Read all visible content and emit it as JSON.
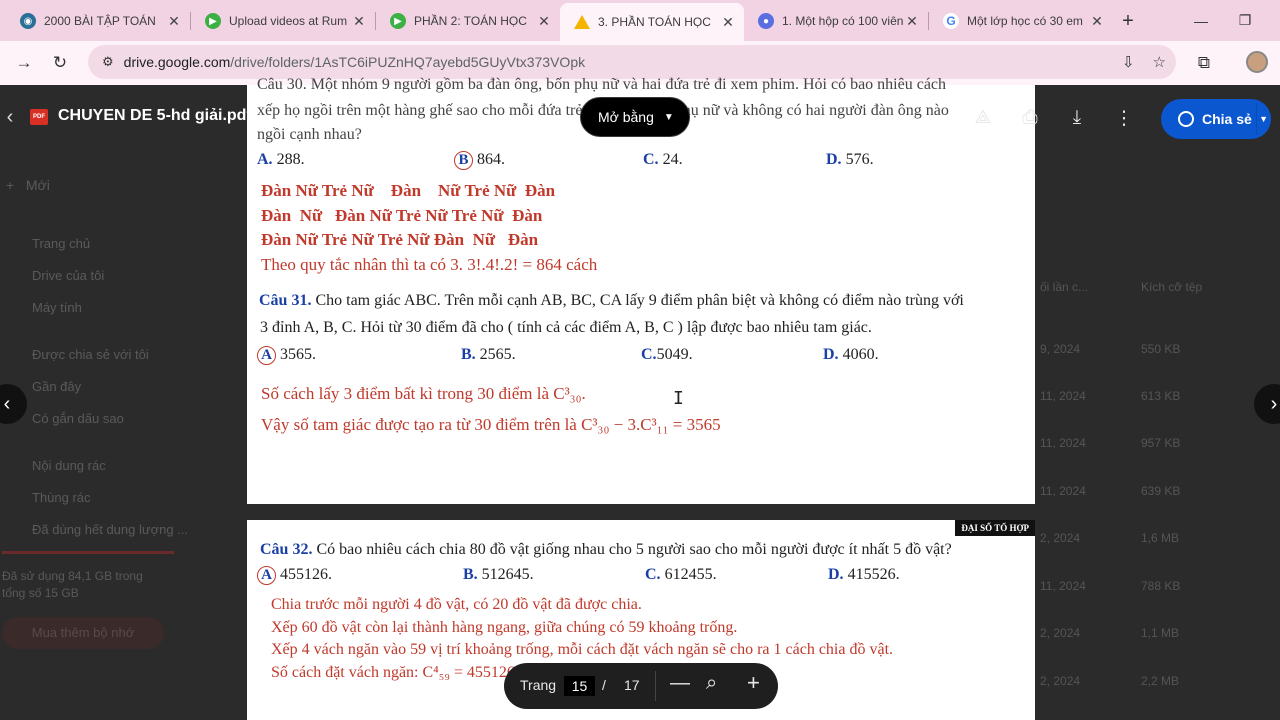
{
  "tabs": [
    {
      "title": "2000 BÀI TẬP TOÁN",
      "color": "#2a6f97"
    },
    {
      "title": "Upload videos at Rum",
      "color": "#3cb043"
    },
    {
      "title": "PHẦN 2: TOÁN HỌC",
      "color": "#3cb043"
    },
    {
      "title": "3. PHẦN TOÁN HỌC",
      "color": "#f4b400",
      "active": true
    },
    {
      "title": "1. Một hộp có 100 viên",
      "color": "#5b6ee1"
    },
    {
      "title": "Một lớp học có 30 em",
      "color": "#ffffff"
    }
  ],
  "address": {
    "host": "drive.google.com",
    "path": "/drive/folders/1AsTC6iPUZnHQ7ayebd5GUyVtx373VOpk"
  },
  "drive_sidebar": {
    "new_label": "Mới",
    "items": [
      "Trang chủ",
      "Drive của tôi",
      "Máy tính",
      "Được chia sẻ với tôi",
      "Gần đây",
      "Có gắn dấu sao",
      "Nội dung rác",
      "Thùng rác",
      "Đã dùng hết dung lượng ..."
    ],
    "storage_text_1": "Đã sử dụng 84,1 GB trong",
    "storage_text_2": "tổng số 15 GB",
    "buy_label": "Mua thêm bộ nhớ"
  },
  "drive_right": {
    "col1": "ối lần c...",
    "col2": "Kích cỡ tệp",
    "rows": [
      {
        "date": "9, 2024",
        "size": "550 KB"
      },
      {
        "date": "11, 2024",
        "size": "613 KB"
      },
      {
        "date": "11, 2024",
        "size": "957 KB"
      },
      {
        "date": "11, 2024",
        "size": "639 KB"
      },
      {
        "date": "2, 2024",
        "size": "1,6 MB"
      },
      {
        "date": "11, 2024",
        "size": "788 KB"
      },
      {
        "date": "2, 2024",
        "size": "1,1 MB"
      },
      {
        "date": "2, 2024",
        "size": "2,2 MB"
      }
    ]
  },
  "pdf": {
    "badge": "PDF",
    "title": "CHUYEN DE 5-hd giải.pdf",
    "open_with": "Mở bằng",
    "share": "Chia sẻ"
  },
  "page1": {
    "ghost1": "Câu 30. Một nhóm 9 người gồm ba đàn ông, bốn phụ nữ và hai đứa trẻ đi xem phim. Hỏi có bao nhiêu cách",
    "ghost2": "xếp họ ngồi trên một hàng ghế sao cho mỗi đứa trẻ ngồi giữa hai phụ nữ và không có hai người đàn ông nào",
    "ghost3": "ngồi cạnh nhau?",
    "q30_opts": [
      {
        "l": "A.",
        "v": "288."
      },
      {
        "l": "B",
        "v": "864."
      },
      {
        "l": "C.",
        "v": "24."
      },
      {
        "l": "D.",
        "v": "576."
      }
    ],
    "arr1": "Đàn Nữ Trẻ Nữ    Đàn    Nữ Trẻ Nữ  Đàn",
    "arr2": "Đàn  Nữ   Đàn Nữ Trẻ Nữ Trẻ Nữ  Đàn",
    "arr3": "Đàn Nữ Trẻ Nữ Trẻ Nữ Đàn  Nữ   Đàn",
    "rule": "Theo quy tắc nhân thì ta có 3. 3!.4!.2! = 864  cách",
    "q31_label": "Câu 31.",
    "q31_l1": " Cho tam giác ABC. Trên mỗi cạnh AB, BC, CA lấy 9 điểm phân biệt và không có điểm nào trùng với",
    "q31_l2": "3 đỉnh A, B, C. Hỏi từ 30 điểm đã cho ( tính cả các điểm A, B, C ) lập được bao nhiêu tam giác.",
    "q31_opts": [
      {
        "l": "A",
        "v": "3565."
      },
      {
        "l": "B.",
        "v": "2565."
      },
      {
        "l": "C.",
        "v": "5049."
      },
      {
        "l": "D.",
        "v": "4060."
      }
    ],
    "sol1": "Số cách lấy 3 điểm bất kì trong 30 điểm là C³₃₀.",
    "sol2": "Vậy số tam giác được tạo ra từ 30 điểm trên là C³₃₀ − 3.C³₁₁ = 3565"
  },
  "page2": {
    "chip": "ĐẠI SỐ TỔ HỢP",
    "q32_label": "Câu 32.",
    "q32": " Có bao nhiêu cách chia 80 đồ vật giống nhau cho 5 người sao cho mỗi người được ít nhất 5 đồ vật?",
    "q32_opts": [
      {
        "l": "A",
        "v": "455126."
      },
      {
        "l": "B.",
        "v": "512645."
      },
      {
        "l": "C.",
        "v": "612455."
      },
      {
        "l": "D.",
        "v": "415526."
      }
    ],
    "s1": "Chia trước mỗi người 4 đồ vật, có 20 đồ vật đã được chia.",
    "s2": "Xếp 60 đồ vật còn lại thành hàng ngang, giữa chúng có 59 khoảng trống.",
    "s3": "Xếp 4 vách ngăn vào 59 vị trí khoảng trống, mỗi cách đặt vách ngăn sẽ cho ra 1 cách chia đồ vật.",
    "s4": "Số cách đặt vách ngăn: C⁴₅₉ = 455126."
  },
  "pager": {
    "label": "Trang",
    "current": "15",
    "slash": "/",
    "total": "17"
  }
}
